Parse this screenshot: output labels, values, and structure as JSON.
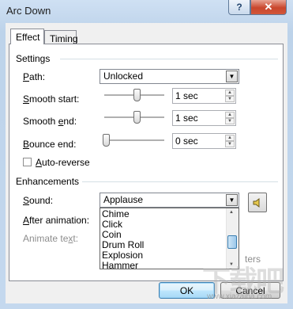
{
  "window": {
    "title": "Arc Down"
  },
  "tabs": [
    {
      "label": "Effect"
    },
    {
      "label": "Timing"
    }
  ],
  "settings": {
    "group_label": "Settings",
    "path": {
      "label": "Path:",
      "value": "Unlocked"
    },
    "smooth_start": {
      "label": "Smooth start:",
      "value": "1 sec",
      "slider_level": 0.55
    },
    "smooth_end": {
      "label": "Smooth end:",
      "value": "1 sec",
      "slider_level": 0.55
    },
    "bounce_end": {
      "label": "Bounce end:",
      "value": "0 sec",
      "slider_level": 0.0
    },
    "auto_reverse": {
      "label": "Auto-reverse",
      "checked": false
    }
  },
  "enhancements": {
    "group_label": "Enhancements",
    "sound": {
      "label": "Sound:",
      "value": "Applause"
    },
    "after_animation": {
      "label": "After animation:"
    },
    "animate_text": {
      "label": "Animate text:"
    },
    "dropdown_items": [
      "Chime",
      "Click",
      "Coin",
      "Drum Roll",
      "Explosion",
      "Hammer"
    ],
    "partial_text": "ters"
  },
  "buttons": {
    "ok": "OK",
    "cancel": "Cancel"
  },
  "watermark": {
    "text": "下载吧",
    "sub": "www.xiazaiba.com"
  },
  "icons": {
    "help": "help-icon",
    "close": "close-icon",
    "speaker": "speaker-icon",
    "dropdown": "dropdown-arrow-icon"
  }
}
